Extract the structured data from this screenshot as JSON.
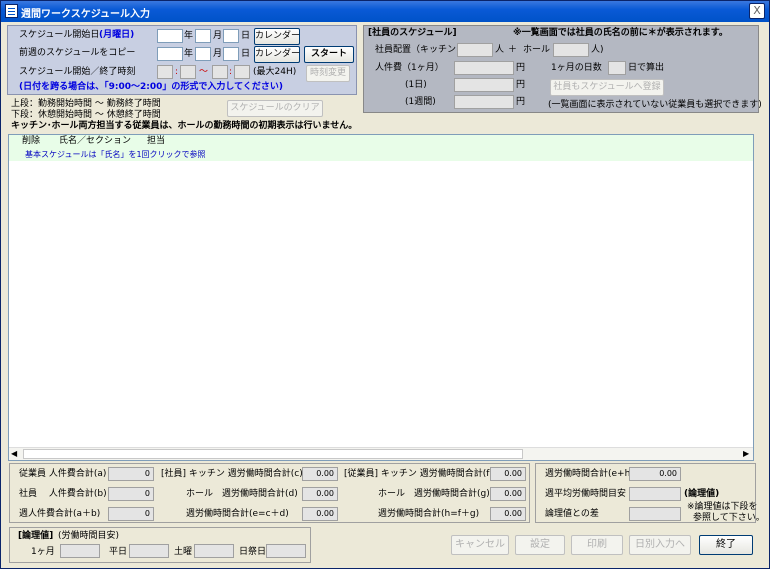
{
  "window": {
    "title": "週間ワークスケジュール入力",
    "close_label": "X"
  },
  "top_left": {
    "start_date_label": "スケジュール開始日",
    "start_date_hint": "(月曜日)",
    "copy_prev_label": "前週のスケジュールをコピー",
    "time_label": "スケジュール開始／終了時刻",
    "year": "年",
    "month": "月",
    "day": "日",
    "calendar_button": "カレンダー",
    "start_button": "スタート",
    "time_colon": ":",
    "time_tilde": "〜",
    "max24": "(最大24H)",
    "time_change_button": "時刻変更",
    "note": "(日付を跨る場合は、「9:00〜2:00」の形式で入力してください)"
  },
  "top_right": {
    "header": "[社員のスケジュール]",
    "notice": "※一覧画面では社員の氏名の前に＊が表示されます。",
    "staff_label": "社員配置（キッチン",
    "person_unit": "人",
    "plus": "＋",
    "hall": "ホール",
    "person_unit_close": "人)",
    "labor_cost_label": "人件費（1ヶ月）",
    "yen": "円",
    "days_label": "1ヶ月の日数",
    "days_suffix": "日で算出",
    "day1_label": "(1日)",
    "week1_label": "(1週間)",
    "register_button": "社員もスケジュールへ登録",
    "register_note": "(一覧画面に表示されていない従業員も選択できます)"
  },
  "legend": {
    "line1": "上段：勤務開始時間 〜 勤務終了時間",
    "line2": "下段：休憩開始時間 〜 休憩終了時間",
    "clear_button": "スケジュールのクリア",
    "warning": "キッチン･ホール両方担当する従業員は、ホールの勤務時間の初期表示は行いません。"
  },
  "grid": {
    "col_delete": "削除",
    "col_name": "氏名／セクション",
    "col_role": "担当",
    "hint": "基本スケジュールは「氏名」を1回クリックで参照"
  },
  "summary": {
    "emp_cost_a": "従業員 人件費合計(a)",
    "emp_cost_a_val": "0",
    "staff_cost_b": "社員　 人件費合計(b)",
    "staff_cost_b_val": "0",
    "week_cost": "週人件費合計(a＋b)",
    "week_cost_val": "0",
    "kitchen_c": "[社員] キッチン 週労働時間合計(c)",
    "kitchen_c_val": "0.00",
    "hall_d": "ホール　週労働時間合計(d)",
    "hall_d_val": "0.00",
    "sum_e": "週労働時間合計(e=c＋d)",
    "sum_e_val": "0.00",
    "kitchen_f": "[従業員] キッチン 週労働時間合計(f)",
    "kitchen_f_val": "0.00",
    "hall_g": "ホール　週労働時間合計(g)",
    "hall_g_val": "0.00",
    "sum_h": "週労働時間合計(h=f＋g)",
    "sum_h_val": "0.00",
    "total_eh": "週労働時間合計(e+h)",
    "total_eh_val": "0.00",
    "avg_target": "週平均労働時間目安",
    "theory": "(論理値)",
    "diff": "論理値との差",
    "theory_note1": "※論理値は下段を",
    "theory_note2": "参照して下さい。"
  },
  "theory_box": {
    "header": "[論理値]",
    "subtitle": "(労働時間目安)",
    "month": "1ヶ月",
    "weekday": "平日",
    "saturday": "土曜",
    "holiday": "日祭日"
  },
  "buttons": {
    "cancel": "キャンセル",
    "settings": "設定",
    "print": "印刷",
    "daily_input": "日別入力へ",
    "exit": "終了"
  }
}
